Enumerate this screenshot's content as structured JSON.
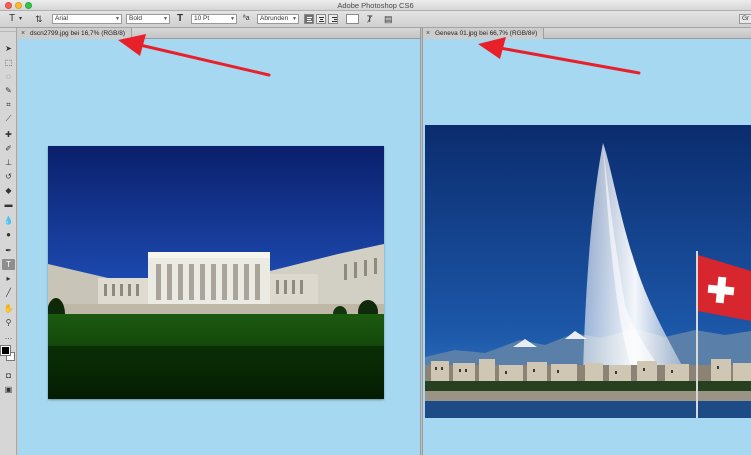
{
  "app": {
    "title": "Adobe Photoshop CS6"
  },
  "options_bar": {
    "font_family": "Arial",
    "font_style": "Bold",
    "font_size": "10 Pt",
    "anti_alias": "Abrunden",
    "right_label": "Gr"
  },
  "documents": [
    {
      "tab_label": "dscn2799.jpg bei 16,7% (RGB/8)",
      "close_glyph": "×"
    },
    {
      "tab_label": "Geneva 01.jpg bei 66,7% (RGB/8#)",
      "close_glyph": "×"
    }
  ],
  "annotations": {
    "arrow_color": "#e8202a"
  },
  "colors": {
    "canvas_bg": "#a7d8f1",
    "foreground": "#000000",
    "background": "#ffffff"
  },
  "icons": {
    "tools": [
      "move-tool-icon",
      "marquee-tool-icon",
      "lasso-tool-icon",
      "quick-select-tool-icon",
      "crop-tool-icon",
      "eyedropper-tool-icon",
      "healing-brush-icon",
      "brush-tool-icon",
      "clone-stamp-icon",
      "history-brush-icon",
      "eraser-tool-icon",
      "gradient-tool-icon",
      "blur-tool-icon",
      "dodge-tool-icon",
      "pen-tool-icon",
      "type-tool-icon",
      "path-select-icon",
      "rectangle-tool-icon",
      "hand-tool-icon",
      "zoom-tool-icon"
    ]
  }
}
